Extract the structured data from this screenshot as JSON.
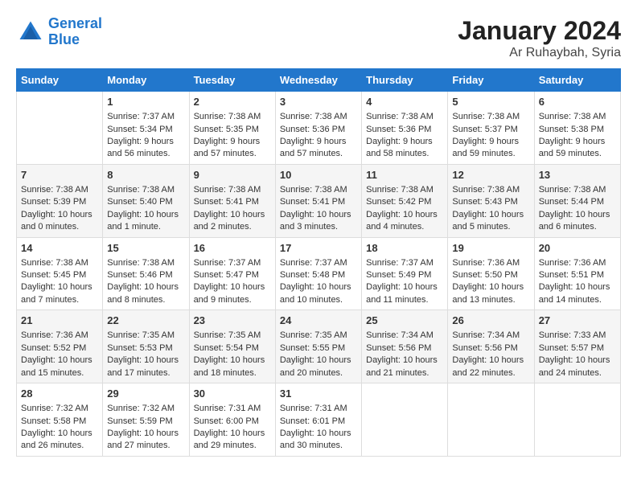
{
  "logo": {
    "line1": "General",
    "line2": "Blue"
  },
  "title": "January 2024",
  "location": "Ar Ruhaybah, Syria",
  "days_of_week": [
    "Sunday",
    "Monday",
    "Tuesday",
    "Wednesday",
    "Thursday",
    "Friday",
    "Saturday"
  ],
  "weeks": [
    [
      {
        "day": "",
        "sunrise": "",
        "sunset": "",
        "daylight": ""
      },
      {
        "day": "1",
        "sunrise": "Sunrise: 7:37 AM",
        "sunset": "Sunset: 5:34 PM",
        "daylight": "Daylight: 9 hours and 56 minutes."
      },
      {
        "day": "2",
        "sunrise": "Sunrise: 7:38 AM",
        "sunset": "Sunset: 5:35 PM",
        "daylight": "Daylight: 9 hours and 57 minutes."
      },
      {
        "day": "3",
        "sunrise": "Sunrise: 7:38 AM",
        "sunset": "Sunset: 5:36 PM",
        "daylight": "Daylight: 9 hours and 57 minutes."
      },
      {
        "day": "4",
        "sunrise": "Sunrise: 7:38 AM",
        "sunset": "Sunset: 5:36 PM",
        "daylight": "Daylight: 9 hours and 58 minutes."
      },
      {
        "day": "5",
        "sunrise": "Sunrise: 7:38 AM",
        "sunset": "Sunset: 5:37 PM",
        "daylight": "Daylight: 9 hours and 59 minutes."
      },
      {
        "day": "6",
        "sunrise": "Sunrise: 7:38 AM",
        "sunset": "Sunset: 5:38 PM",
        "daylight": "Daylight: 9 hours and 59 minutes."
      }
    ],
    [
      {
        "day": "7",
        "sunrise": "Sunrise: 7:38 AM",
        "sunset": "Sunset: 5:39 PM",
        "daylight": "Daylight: 10 hours and 0 minutes."
      },
      {
        "day": "8",
        "sunrise": "Sunrise: 7:38 AM",
        "sunset": "Sunset: 5:40 PM",
        "daylight": "Daylight: 10 hours and 1 minute."
      },
      {
        "day": "9",
        "sunrise": "Sunrise: 7:38 AM",
        "sunset": "Sunset: 5:41 PM",
        "daylight": "Daylight: 10 hours and 2 minutes."
      },
      {
        "day": "10",
        "sunrise": "Sunrise: 7:38 AM",
        "sunset": "Sunset: 5:41 PM",
        "daylight": "Daylight: 10 hours and 3 minutes."
      },
      {
        "day": "11",
        "sunrise": "Sunrise: 7:38 AM",
        "sunset": "Sunset: 5:42 PM",
        "daylight": "Daylight: 10 hours and 4 minutes."
      },
      {
        "day": "12",
        "sunrise": "Sunrise: 7:38 AM",
        "sunset": "Sunset: 5:43 PM",
        "daylight": "Daylight: 10 hours and 5 minutes."
      },
      {
        "day": "13",
        "sunrise": "Sunrise: 7:38 AM",
        "sunset": "Sunset: 5:44 PM",
        "daylight": "Daylight: 10 hours and 6 minutes."
      }
    ],
    [
      {
        "day": "14",
        "sunrise": "Sunrise: 7:38 AM",
        "sunset": "Sunset: 5:45 PM",
        "daylight": "Daylight: 10 hours and 7 minutes."
      },
      {
        "day": "15",
        "sunrise": "Sunrise: 7:38 AM",
        "sunset": "Sunset: 5:46 PM",
        "daylight": "Daylight: 10 hours and 8 minutes."
      },
      {
        "day": "16",
        "sunrise": "Sunrise: 7:37 AM",
        "sunset": "Sunset: 5:47 PM",
        "daylight": "Daylight: 10 hours and 9 minutes."
      },
      {
        "day": "17",
        "sunrise": "Sunrise: 7:37 AM",
        "sunset": "Sunset: 5:48 PM",
        "daylight": "Daylight: 10 hours and 10 minutes."
      },
      {
        "day": "18",
        "sunrise": "Sunrise: 7:37 AM",
        "sunset": "Sunset: 5:49 PM",
        "daylight": "Daylight: 10 hours and 11 minutes."
      },
      {
        "day": "19",
        "sunrise": "Sunrise: 7:36 AM",
        "sunset": "Sunset: 5:50 PM",
        "daylight": "Daylight: 10 hours and 13 minutes."
      },
      {
        "day": "20",
        "sunrise": "Sunrise: 7:36 AM",
        "sunset": "Sunset: 5:51 PM",
        "daylight": "Daylight: 10 hours and 14 minutes."
      }
    ],
    [
      {
        "day": "21",
        "sunrise": "Sunrise: 7:36 AM",
        "sunset": "Sunset: 5:52 PM",
        "daylight": "Daylight: 10 hours and 15 minutes."
      },
      {
        "day": "22",
        "sunrise": "Sunrise: 7:35 AM",
        "sunset": "Sunset: 5:53 PM",
        "daylight": "Daylight: 10 hours and 17 minutes."
      },
      {
        "day": "23",
        "sunrise": "Sunrise: 7:35 AM",
        "sunset": "Sunset: 5:54 PM",
        "daylight": "Daylight: 10 hours and 18 minutes."
      },
      {
        "day": "24",
        "sunrise": "Sunrise: 7:35 AM",
        "sunset": "Sunset: 5:55 PM",
        "daylight": "Daylight: 10 hours and 20 minutes."
      },
      {
        "day": "25",
        "sunrise": "Sunrise: 7:34 AM",
        "sunset": "Sunset: 5:56 PM",
        "daylight": "Daylight: 10 hours and 21 minutes."
      },
      {
        "day": "26",
        "sunrise": "Sunrise: 7:34 AM",
        "sunset": "Sunset: 5:56 PM",
        "daylight": "Daylight: 10 hours and 22 minutes."
      },
      {
        "day": "27",
        "sunrise": "Sunrise: 7:33 AM",
        "sunset": "Sunset: 5:57 PM",
        "daylight": "Daylight: 10 hours and 24 minutes."
      }
    ],
    [
      {
        "day": "28",
        "sunrise": "Sunrise: 7:32 AM",
        "sunset": "Sunset: 5:58 PM",
        "daylight": "Daylight: 10 hours and 26 minutes."
      },
      {
        "day": "29",
        "sunrise": "Sunrise: 7:32 AM",
        "sunset": "Sunset: 5:59 PM",
        "daylight": "Daylight: 10 hours and 27 minutes."
      },
      {
        "day": "30",
        "sunrise": "Sunrise: 7:31 AM",
        "sunset": "Sunset: 6:00 PM",
        "daylight": "Daylight: 10 hours and 29 minutes."
      },
      {
        "day": "31",
        "sunrise": "Sunrise: 7:31 AM",
        "sunset": "Sunset: 6:01 PM",
        "daylight": "Daylight: 10 hours and 30 minutes."
      },
      {
        "day": "",
        "sunrise": "",
        "sunset": "",
        "daylight": ""
      },
      {
        "day": "",
        "sunrise": "",
        "sunset": "",
        "daylight": ""
      },
      {
        "day": "",
        "sunrise": "",
        "sunset": "",
        "daylight": ""
      }
    ]
  ]
}
